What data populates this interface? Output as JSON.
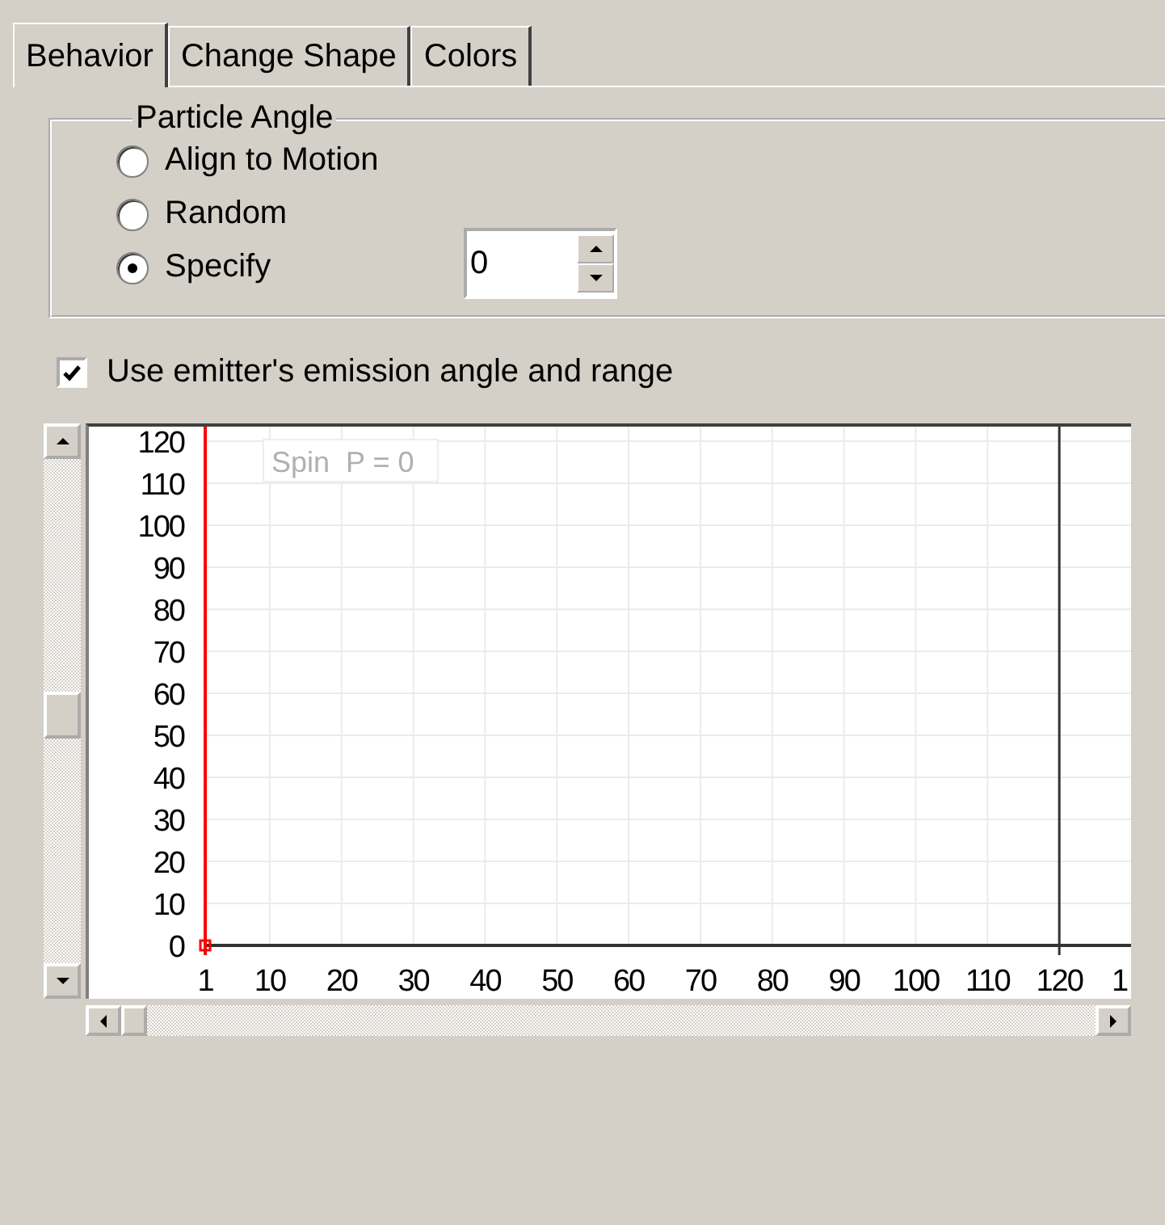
{
  "tabs": [
    {
      "label": "Behavior",
      "selected": true
    },
    {
      "label": "Change Shape",
      "selected": false
    },
    {
      "label": "Colors",
      "selected": false
    }
  ],
  "particle_angle": {
    "title": "Particle Angle",
    "options": [
      {
        "label": "Align to Motion",
        "selected": false
      },
      {
        "label": "Random",
        "selected": false
      },
      {
        "label": "Specify",
        "selected": true
      }
    ],
    "specify_value": "0"
  },
  "use_emitter_angle": {
    "label": "Use emitter's emission angle and range",
    "checked": true
  },
  "graph": {
    "chart_data": {
      "type": "line",
      "x": [
        1
      ],
      "series": [
        {
          "name": "Spin",
          "color": "#ff0000",
          "marker": "square",
          "values": [
            0
          ]
        }
      ],
      "xlim": [
        1,
        130
      ],
      "ylim": [
        0,
        120
      ],
      "grid": true,
      "xticks": [
        1,
        10,
        20,
        30,
        40,
        50,
        60,
        70,
        80,
        90,
        100,
        110,
        120
      ],
      "yticks": [
        0,
        10,
        20,
        30,
        40,
        50,
        60,
        70,
        80,
        90,
        100,
        110,
        120
      ],
      "ref_lines": [
        {
          "axis": "x",
          "value": 120,
          "color": "#333333"
        }
      ],
      "annotations": [
        "P = 0"
      ]
    },
    "cut_off_tick_label": "1"
  }
}
